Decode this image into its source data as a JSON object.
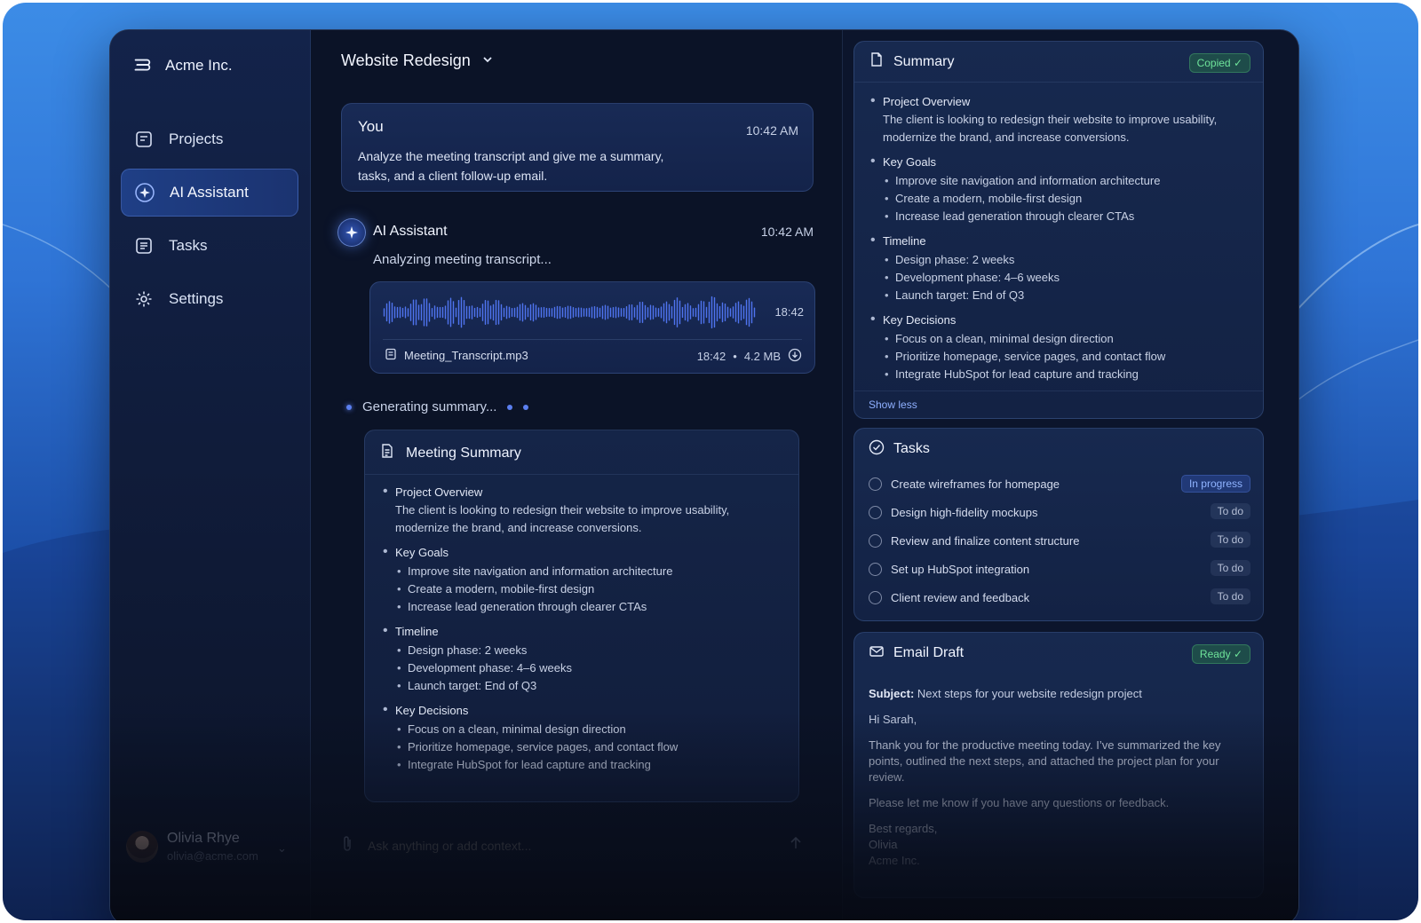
{
  "brand": {
    "name": "Acme Inc."
  },
  "nav": [
    {
      "label": "Projects"
    },
    {
      "label": "AI Assistant"
    },
    {
      "label": "Tasks"
    },
    {
      "label": "Settings"
    }
  ],
  "user": {
    "name": "Olivia Rhye",
    "email": "olivia@acme.com"
  },
  "chat": {
    "title": "Website Redesign",
    "you": {
      "label": "You",
      "time": "10:42 AM",
      "text": "Analyze the meeting transcript and give me a summary, tasks, and a client follow-up email."
    },
    "assistant": {
      "name": "AI Assistant",
      "time": "10:42 AM",
      "status": "Analyzing meeting transcript..."
    },
    "audio": {
      "duration": "18:42",
      "file_name": "Meeting_Transcript.mp3",
      "meta_duration": "18:42",
      "separator": "•",
      "size": "4.2 MB"
    },
    "generating": "Generating summary...",
    "meeting_summary": {
      "title": "Meeting Summary",
      "overview_head": "Project Overview",
      "overview_text": "The client is looking to redesign their website to improve usability, modernize the brand, and increase conversions.",
      "goals_head": "Key Goals",
      "goals": [
        "Improve site navigation and information architecture",
        "Create a modern, mobile-first design",
        "Increase lead generation through clearer CTAs"
      ],
      "timeline_head": "Timeline",
      "timeline": [
        "Design phase: 2 weeks",
        "Development phase: 4–6 weeks",
        "Launch target: End of Q3"
      ],
      "decisions_head": "Key Decisions",
      "decisions": [
        "Focus on a clean, minimal design direction",
        "Prioritize homepage, service pages, and contact flow",
        "Integrate HubSpot for lead capture and tracking"
      ]
    },
    "composer_placeholder": "Ask anything or add context..."
  },
  "summary": {
    "title": "Summary",
    "badge": "Copied ✓",
    "overview_head": "Project Overview",
    "overview_text": "The client is looking to redesign their website to improve usability, modernize the brand, and increase conversions.",
    "goals_head": "Key Goals",
    "goals": [
      "Improve site navigation and information architecture",
      "Create a modern, mobile-first design",
      "Increase lead generation through clearer CTAs"
    ],
    "timeline_head": "Timeline",
    "timeline": [
      "Design phase: 2 weeks",
      "Development phase: 4–6 weeks",
      "Launch target: End of Q3"
    ],
    "decisions_head": "Key Decisions",
    "decisions": [
      "Focus on a clean, minimal design direction",
      "Prioritize homepage, service pages, and contact flow",
      "Integrate HubSpot for lead capture and tracking"
    ],
    "show_less": "Show less"
  },
  "tasks": {
    "title": "Tasks",
    "items": [
      {
        "label": "Create wireframes for homepage",
        "status": "In progress"
      },
      {
        "label": "Design high-fidelity mockups",
        "status": "To do"
      },
      {
        "label": "Review and finalize content structure",
        "status": "To do"
      },
      {
        "label": "Set up HubSpot integration",
        "status": "To do"
      },
      {
        "label": "Client review and feedback",
        "status": "To do"
      }
    ]
  },
  "email": {
    "title": "Email Draft",
    "badge": "Ready ✓",
    "subject_label": "Subject:",
    "subject": "Next steps for your website redesign project",
    "greeting": "Hi Sarah,",
    "body": "Thank you for the productive meeting today. I’ve summarized the key points, outlined the next steps, and attached the project plan for your review.",
    "closing_line": "Please let me know if you have any questions or feedback.",
    "signoff": "Best regards,",
    "sender": "Olivia",
    "company": "Acme Inc."
  },
  "colors": {
    "accent": "#3b6ef0",
    "success": "#6ee39a",
    "background": "#0b1327"
  }
}
